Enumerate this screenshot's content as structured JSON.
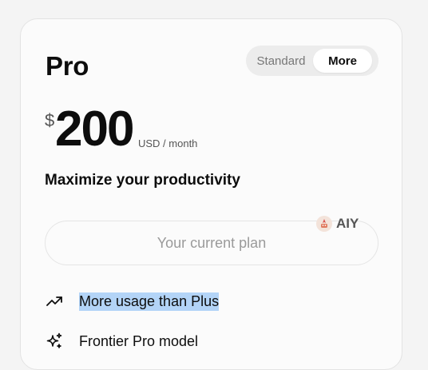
{
  "plan": {
    "name": "Pro",
    "currency_symbol": "$",
    "price": "200",
    "period": "USD / month",
    "tagline": "Maximize your productivity",
    "current_plan_label": "Your current plan"
  },
  "toggle": {
    "options": [
      "Standard",
      "More"
    ],
    "selected": "More"
  },
  "overlay_badge": {
    "label": "AIY",
    "icon": "aiy-logo-icon"
  },
  "features": [
    {
      "icon": "trend-up-icon",
      "label": "More usage than Plus",
      "selected_text": true
    },
    {
      "icon": "sparkles-icon",
      "label": "Frontier Pro model"
    }
  ],
  "colors": {
    "background": "#f4f4f4",
    "card": "#fbfbfb",
    "selection_highlight": "#b3d4f7",
    "muted_text": "#9a9a9a"
  }
}
